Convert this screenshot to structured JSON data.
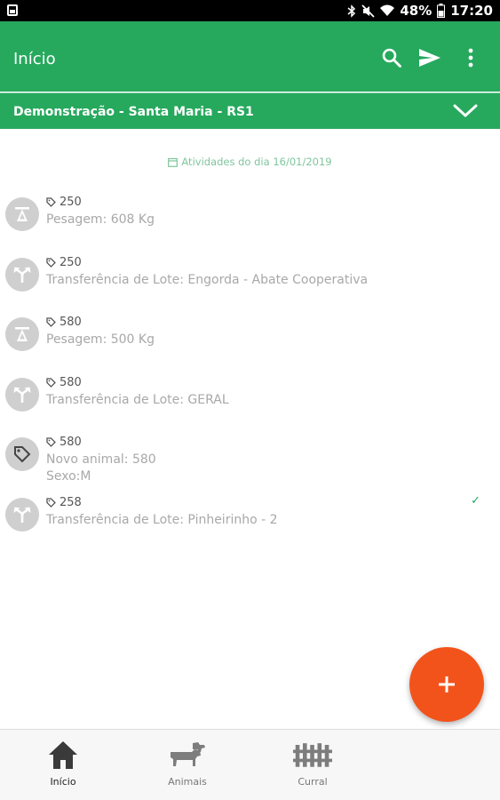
{
  "status_bar": {
    "battery": "48%",
    "time": "17:20"
  },
  "header": {
    "title": "Início",
    "actions": [
      "search-icon",
      "send-icon",
      "more-vert-icon"
    ]
  },
  "farm_selector": {
    "label": "Demonstração - Santa Maria - RS1"
  },
  "date_header": {
    "label": "Atividades do dia 16/01/2019"
  },
  "activities": [
    {
      "tag": "250",
      "line1": "Pesagem: 608 Kg",
      "line2": "",
      "icon": "scale-icon",
      "synced": false
    },
    {
      "tag": "250",
      "line1": "Transferência de Lote: Engorda - Abate Cooperativa",
      "line2": "",
      "icon": "transfer-icon",
      "synced": false
    },
    {
      "tag": "580",
      "line1": "Pesagem: 500 Kg",
      "line2": "",
      "icon": "scale-icon",
      "synced": false
    },
    {
      "tag": "580",
      "line1": "Transferência de Lote: GERAL",
      "line2": "",
      "icon": "transfer-icon",
      "synced": false
    },
    {
      "tag": "580",
      "line1": "Novo animal: 580",
      "line2": "Sexo:M",
      "icon": "tag-icon",
      "synced": false
    },
    {
      "tag": "258",
      "line1": "Transferência de Lote: Pinheirinho - 2",
      "line2": "",
      "icon": "transfer-icon",
      "synced": true,
      "synced_mark": "✓"
    }
  ],
  "fab": {
    "label": "+"
  },
  "bottom_nav": [
    {
      "label": "Início",
      "icon": "home-icon",
      "active": true
    },
    {
      "label": "Animais",
      "icon": "cattle-icon",
      "active": false
    },
    {
      "label": "Curral",
      "icon": "fence-icon",
      "active": false
    }
  ],
  "colors": {
    "primary": "#26a95d",
    "accent": "#f2531b",
    "avatar_bg": "#cfcfcf",
    "muted_text": "#a8a8a8"
  }
}
